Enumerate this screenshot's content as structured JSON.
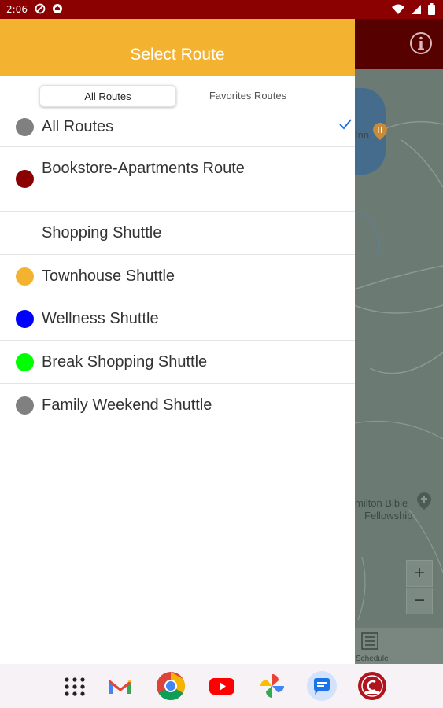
{
  "status_bar": {
    "time": "2:06",
    "left_icons": [
      "block-icon",
      "shield-icon"
    ],
    "right_icons": [
      "wifi-icon",
      "signal-icon",
      "battery-icon"
    ]
  },
  "drawer": {
    "title": "Select Route",
    "tabs": [
      {
        "label": "All Routes",
        "selected": true
      },
      {
        "label": "Favorites Routes",
        "selected": false
      }
    ],
    "routes": [
      {
        "label": "All Routes",
        "color": "#808080",
        "checked": true
      },
      {
        "label": "Bookstore-Apartments Route",
        "color": "#8b0000",
        "checked": false
      },
      {
        "label": "Shopping Shuttle",
        "color": "",
        "checked": false
      },
      {
        "label": "Townhouse Shuttle",
        "color": "#f3b330",
        "checked": false
      },
      {
        "label": "Wellness Shuttle",
        "color": "#0000ff",
        "checked": false
      },
      {
        "label": "Break Shopping Shuttle",
        "color": "#00ff00",
        "checked": false
      },
      {
        "label": "Family Weekend Shuttle",
        "color": "#808080",
        "checked": false
      }
    ]
  },
  "map": {
    "labels": {
      "poi_fragment": "Inn",
      "church_line1": "milton Bible",
      "church_line2": "Fellowship"
    },
    "zoom_in": "+",
    "zoom_out": "−",
    "schedule_label": "Schedule",
    "info_icon": "info-icon"
  },
  "dock": {
    "apps": [
      "apps-grid-icon",
      "gmail-icon",
      "chrome-icon",
      "youtube-icon",
      "photos-icon",
      "messages-icon",
      "campus-app-icon"
    ]
  },
  "colors": {
    "status_bar": "#8b0000",
    "header": "#f3b330",
    "map_header": "#560000",
    "check": "#1a73e8"
  }
}
